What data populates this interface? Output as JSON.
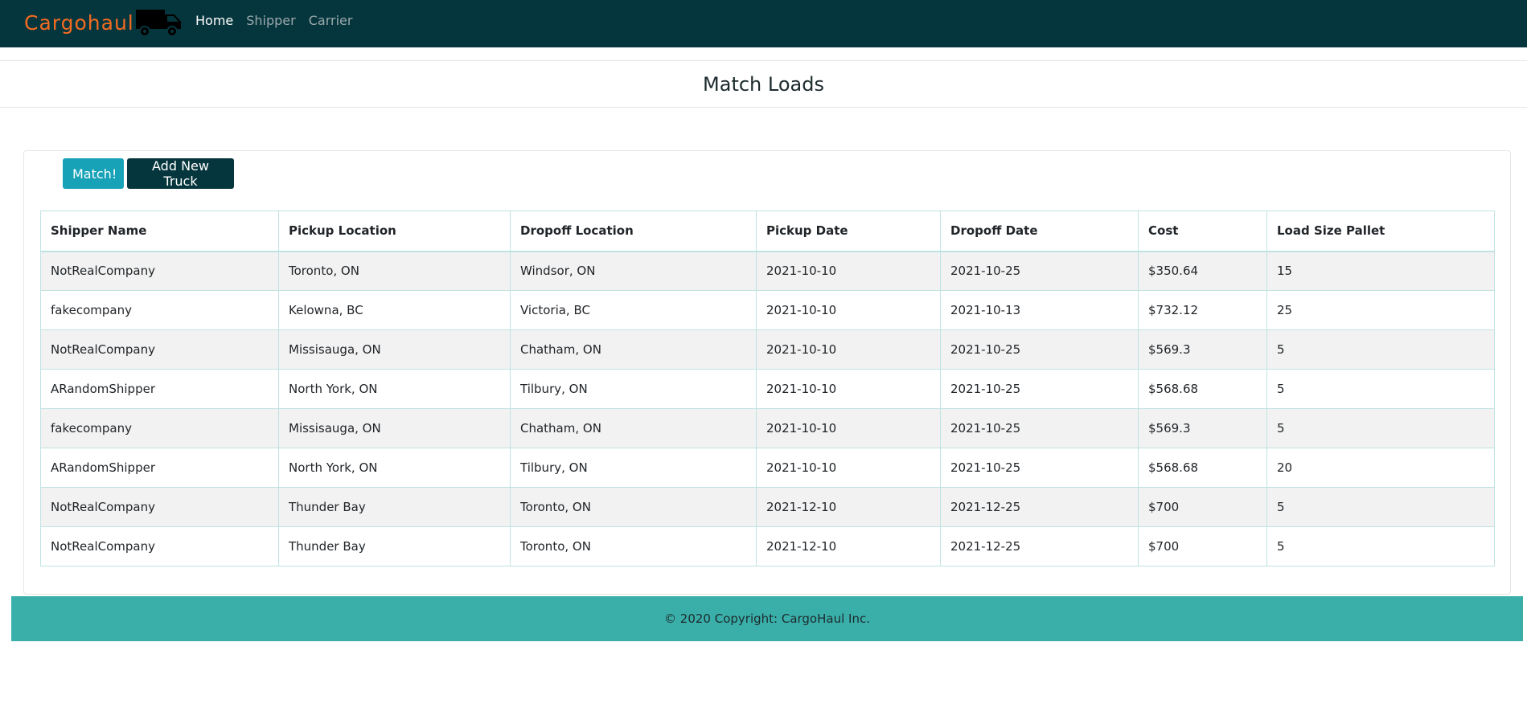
{
  "navbar": {
    "brand": "Cargohaul",
    "links": [
      {
        "label": "Home",
        "active": true
      },
      {
        "label": "Shipper",
        "active": false
      },
      {
        "label": "Carrier",
        "active": false
      }
    ]
  },
  "page": {
    "title": "Match Loads"
  },
  "actions": {
    "match_label": "Match!",
    "add_truck_label": "Add New Truck"
  },
  "table": {
    "headers": [
      "Shipper Name",
      "Pickup Location",
      "Dropoff Location",
      "Pickup Date",
      "Dropoff Date",
      "Cost",
      "Load Size Pallet"
    ],
    "rows": [
      [
        "NotRealCompany",
        "Toronto, ON",
        "Windsor, ON",
        "2021-10-10",
        "2021-10-25",
        "$350.64",
        "15"
      ],
      [
        "fakecompany",
        "Kelowna, BC",
        "Victoria, BC",
        "2021-10-10",
        "2021-10-13",
        "$732.12",
        "25"
      ],
      [
        "NotRealCompany",
        "Missisauga, ON",
        "Chatham, ON",
        "2021-10-10",
        "2021-10-25",
        "$569.3",
        "5"
      ],
      [
        "ARandomShipper",
        "North York, ON",
        "Tilbury, ON",
        "2021-10-10",
        "2021-10-25",
        "$568.68",
        "5"
      ],
      [
        "fakecompany",
        "Missisauga, ON",
        "Chatham, ON",
        "2021-10-10",
        "2021-10-25",
        "$569.3",
        "5"
      ],
      [
        "ARandomShipper",
        "North York, ON",
        "Tilbury, ON",
        "2021-10-10",
        "2021-10-25",
        "$568.68",
        "20"
      ],
      [
        "NotRealCompany",
        "Thunder Bay",
        "Toronto, ON",
        "2021-12-10",
        "2021-12-25",
        "$700",
        "5"
      ],
      [
        "NotRealCompany",
        "Thunder Bay",
        "Toronto, ON",
        "2021-12-10",
        "2021-12-25",
        "$700",
        "5"
      ]
    ]
  },
  "footer": {
    "text": "© 2020 Copyright: CargoHaul Inc."
  },
  "colors": {
    "navbar_bg": "#06363d",
    "brand_orange": "#f26b21",
    "match_button": "#17a2b8",
    "add_button": "#06363d",
    "footer_bg": "#3aafa9"
  },
  "icons": {
    "brand_icon": "truck-icon"
  }
}
